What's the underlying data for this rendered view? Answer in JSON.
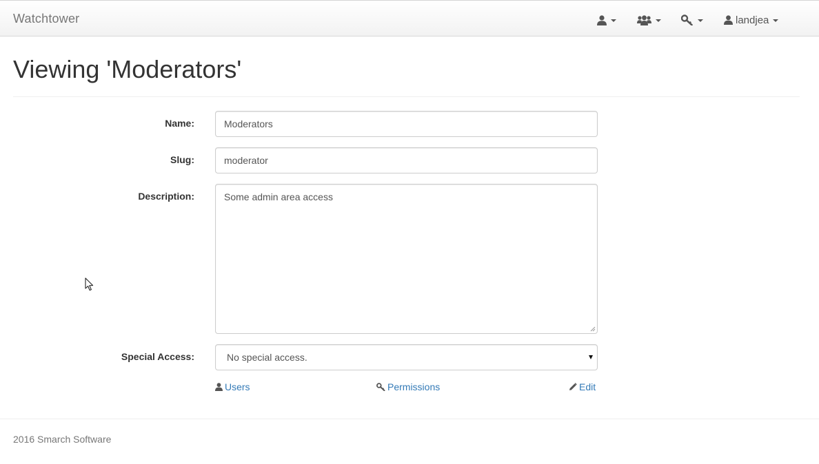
{
  "navbar": {
    "brand": "Watchtower",
    "icons": [
      "user-icon",
      "users-icon",
      "key-icon"
    ],
    "user_label": "landjea"
  },
  "page": {
    "title": "Viewing 'Moderators'"
  },
  "form": {
    "name_label": "Name:",
    "name_value": "Moderators",
    "slug_label": "Slug:",
    "slug_value": "moderator",
    "description_label": "Description:",
    "description_value": "Some admin area access",
    "special_access_label": "Special Access:",
    "special_access_value": "No special access."
  },
  "actions": {
    "users_label": "Users",
    "permissions_label": "Permissions",
    "edit_label": "Edit"
  },
  "footer": {
    "text": "2016 Smarch Software"
  },
  "colors": {
    "link": "#337ab7",
    "muted": "#777777",
    "text": "#333333"
  }
}
